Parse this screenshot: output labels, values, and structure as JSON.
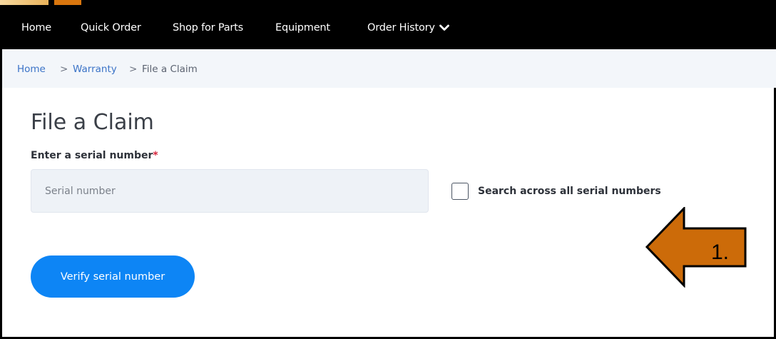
{
  "nav": {
    "items": [
      "Home",
      "Quick Order",
      "Shop for Parts",
      "Equipment"
    ],
    "order_history": "Order History"
  },
  "breadcrumb": {
    "home": "Home",
    "sep": ">",
    "warranty": "Warranty",
    "current": "File a Claim"
  },
  "page": {
    "title": "File a Claim",
    "field_label": "Enter a serial number",
    "required_mark": "*",
    "serial_placeholder": "Serial number",
    "checkbox_label": "Search across all serial numbers",
    "verify_button": "Verify serial number"
  },
  "annotation": {
    "number": "1.",
    "color": "#cc6b09"
  },
  "colors": {
    "nav_bg": "#000000",
    "accent_button": "#0d85f5",
    "link": "#3b73c7",
    "required": "#d7263d"
  },
  "icons": {
    "order_history_dropdown": "chevron-down-icon"
  }
}
